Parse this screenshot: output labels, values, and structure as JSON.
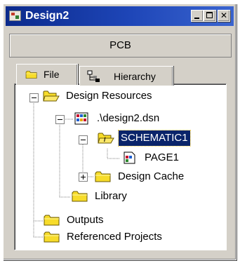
{
  "window": {
    "title": "Design2",
    "icon": "orcad-project-icon",
    "controls": [
      "minimize-icon",
      "maximize-icon",
      "close-icon"
    ]
  },
  "header": {
    "label": "PCB"
  },
  "tabs": [
    {
      "label": "File",
      "icon": "folder-icon",
      "active": true
    },
    {
      "label": "Hierarchy",
      "icon": "hierarchy-icon",
      "active": false
    }
  ],
  "tree": {
    "design_resources": "Design Resources",
    "design_file": ".\\design2.dsn",
    "schematic": "SCHEMATIC1",
    "page": "PAGE1",
    "design_cache": "Design Cache",
    "library": "Library",
    "outputs": "Outputs",
    "referenced_projects": "Referenced Projects"
  },
  "colors": {
    "title_bar": "#0b2a8c",
    "selection": "#0a246a",
    "folder": "#f5d300",
    "face": "#d4d0c8"
  }
}
